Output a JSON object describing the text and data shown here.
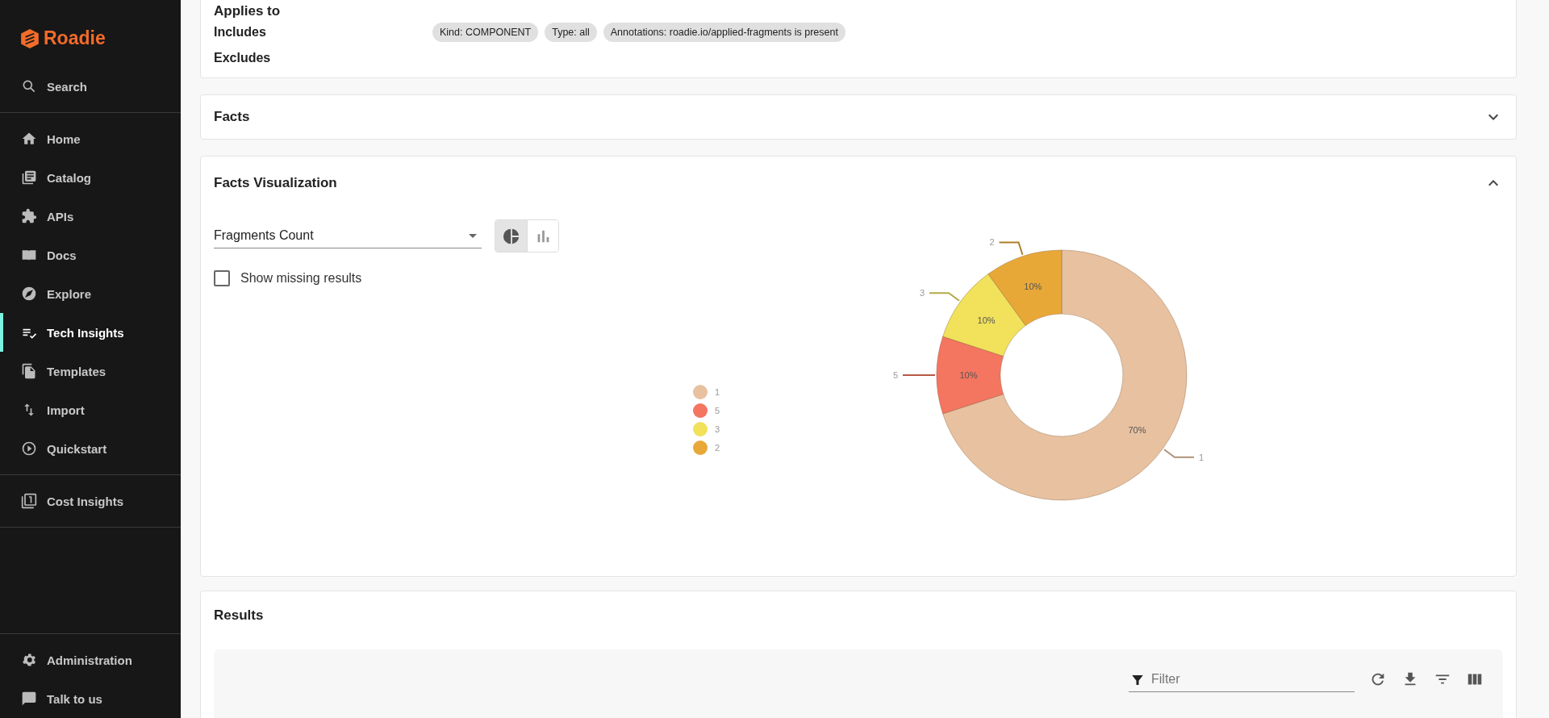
{
  "sidebar": {
    "logo": "Roadie",
    "search": "Search",
    "groups": [
      [
        {
          "label": "Home",
          "selected": false
        },
        {
          "label": "Catalog",
          "selected": false
        },
        {
          "label": "APIs",
          "selected": false
        },
        {
          "label": "Docs",
          "selected": false
        },
        {
          "label": "Explore",
          "selected": false
        },
        {
          "label": "Tech Insights",
          "selected": true
        },
        {
          "label": "Templates",
          "selected": false
        },
        {
          "label": "Import",
          "selected": false
        },
        {
          "label": "Quickstart",
          "selected": false
        }
      ],
      [
        {
          "label": "Cost Insights",
          "selected": false
        }
      ]
    ],
    "bottom": [
      {
        "label": "Administration",
        "selected": false
      },
      {
        "label": "Talk to us",
        "selected": false
      }
    ]
  },
  "applies_to": {
    "title": "Applies to",
    "includes_label": "Includes",
    "includes": [
      "Kind: COMPONENT",
      "Type: all",
      "Annotations: roadie.io/applied-fragments is present"
    ],
    "excludes_label": "Excludes"
  },
  "facts": {
    "title": "Facts",
    "expanded": false
  },
  "facts_visualization": {
    "title": "Facts Visualization",
    "expanded": true,
    "select": {
      "value": "Fragments Count"
    },
    "chart_toggle": [
      {
        "kind": "pie",
        "selected": true
      },
      {
        "kind": "bar",
        "selected": false
      }
    ],
    "show_missing": {
      "label": "Show missing results",
      "checked": false
    },
    "chart_data": {
      "type": "donut",
      "categories": [
        "1",
        "5",
        "3",
        "2"
      ],
      "values": [
        70,
        10,
        10,
        10
      ],
      "value_labels": [
        "70%",
        "10%",
        "10%",
        "10%"
      ],
      "legend": true
    }
  },
  "results": {
    "title": "Results",
    "filter": {
      "placeholder": "Filter"
    }
  }
}
